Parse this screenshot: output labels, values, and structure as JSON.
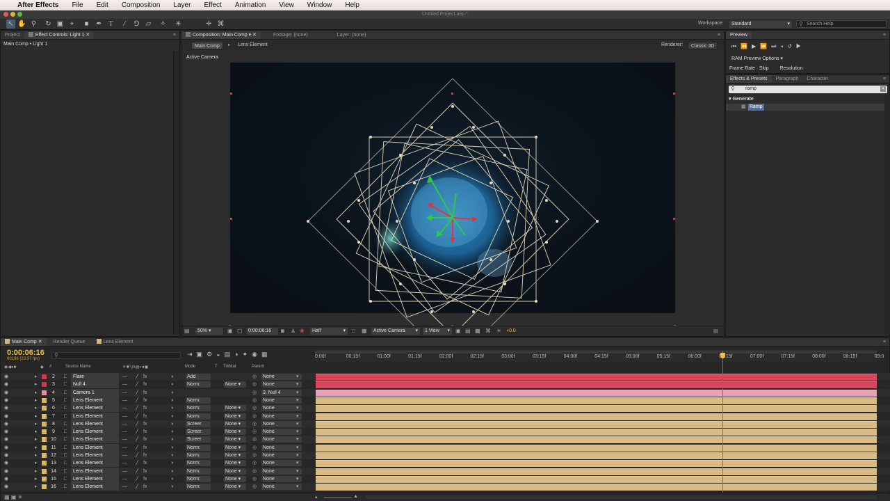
{
  "menubar": {
    "apple": "",
    "app": "After Effects",
    "items": [
      "File",
      "Edit",
      "Composition",
      "Layer",
      "Effect",
      "Animation",
      "View",
      "Window",
      "Help"
    ]
  },
  "window_title": "Untitled Project.aep *",
  "toolbar": {
    "workspace_label": "Workspace:",
    "workspace_value": "Standard",
    "search_placeholder": "Search Help"
  },
  "project_panel": {
    "tabs": [
      "Project",
      "Effect Controls: Light 1"
    ],
    "breadcrumb": "Main Comp • Light 1"
  },
  "comp_panel": {
    "tabs": [
      "Composition: Main Comp",
      "Footage: (none)",
      "Layer: (none)"
    ],
    "subtabs": [
      "Main Comp",
      "Lens Element"
    ],
    "renderer_label": "Renderer:",
    "renderer_value": "Classic 3D",
    "view_label": "Active Camera",
    "footer": {
      "zoom": "50%",
      "timecode": "0:00:06:16",
      "resolution": "Half",
      "camera": "Active Camera",
      "view": "1 View",
      "exposure": "+0.0"
    }
  },
  "preview_panel": {
    "title": "Preview",
    "ram_label": "RAM Preview Options",
    "cols": [
      "Frame Rate",
      "Skip",
      "Resolution"
    ]
  },
  "effects_panel": {
    "tabs": [
      "Effects & Presets",
      "Paragraph",
      "Character"
    ],
    "search": "ramp",
    "category": "Generate",
    "item": "Ramp"
  },
  "timeline": {
    "tabs": [
      "Main Comp",
      "Render Queue",
      "Lens Element"
    ],
    "timecode": "0:00:06:16",
    "frames": "00196 (29.97 fps)",
    "col_headers": {
      "num": "#",
      "source": "Source Name",
      "mode": "Mode",
      "t": "T",
      "trkmat": "TrkMat",
      "parent": "Parent"
    },
    "ruler": [
      "0:00f",
      "00:15f",
      "01:00f",
      "01:15f",
      "02:00f",
      "02:15f",
      "03:00f",
      "03:15f",
      "04:00f",
      "04:15f",
      "05:00f",
      "05:15f",
      "06:00f",
      "06:15f",
      "07:00f",
      "07:15f",
      "08:00f",
      "08:15f",
      "09:0"
    ],
    "playhead_fraction": 0.725,
    "layers": [
      {
        "num": "2",
        "name": "Flare",
        "label": "#c83a4a",
        "mode": "Add",
        "trkmat": "",
        "parent": "None",
        "bar": "#d9465c"
      },
      {
        "num": "3",
        "name": "Null 4",
        "label": "#c83a4a",
        "mode": "Norm:",
        "trkmat": "None",
        "parent": "None",
        "bar": "#d9465c"
      },
      {
        "num": "4",
        "name": "Camera 1",
        "label": "#e78fa6",
        "mode": "",
        "trkmat": "",
        "parent": "3. Null 4",
        "bar": "#e8a2b6"
      },
      {
        "num": "5",
        "name": "Lens Element",
        "label": "#d7b86a",
        "mode": "Norm:",
        "trkmat": "",
        "parent": "None",
        "bar": "#d8bb85"
      },
      {
        "num": "6",
        "name": "Lens Element",
        "label": "#d7b86a",
        "mode": "Norm:",
        "trkmat": "None",
        "parent": "None",
        "bar": "#d8bb85"
      },
      {
        "num": "7",
        "name": "Lens Element",
        "label": "#d7b86a",
        "mode": "Norm:",
        "trkmat": "None",
        "parent": "None",
        "bar": "#d8bb85"
      },
      {
        "num": "8",
        "name": "Lens Element",
        "label": "#d7b86a",
        "mode": "Screer",
        "trkmat": "None",
        "parent": "None",
        "bar": "#d8bb85"
      },
      {
        "num": "9",
        "name": "Lens Element",
        "label": "#d7b86a",
        "mode": "Screer",
        "trkmat": "None",
        "parent": "None",
        "bar": "#d8bb85"
      },
      {
        "num": "10",
        "name": "Lens Element",
        "label": "#d7b86a",
        "mode": "Screer",
        "trkmat": "None",
        "parent": "None",
        "bar": "#d8bb85"
      },
      {
        "num": "11",
        "name": "Lens Element",
        "label": "#d7b86a",
        "mode": "Norm:",
        "trkmat": "None",
        "parent": "None",
        "bar": "#d8bb85"
      },
      {
        "num": "12",
        "name": "Lens Element",
        "label": "#d7b86a",
        "mode": "Norm:",
        "trkmat": "None",
        "parent": "None",
        "bar": "#d8bb85"
      },
      {
        "num": "13",
        "name": "Lens Element",
        "label": "#d7b86a",
        "mode": "Norm:",
        "trkmat": "None",
        "parent": "None",
        "bar": "#d8bb85"
      },
      {
        "num": "14",
        "name": "Lens Element",
        "label": "#d7b86a",
        "mode": "Norm:",
        "trkmat": "None",
        "parent": "None",
        "bar": "#d8bb85"
      },
      {
        "num": "15",
        "name": "Lens Element",
        "label": "#d7b86a",
        "mode": "Norm:",
        "trkmat": "None",
        "parent": "None",
        "bar": "#d8bb85"
      },
      {
        "num": "16",
        "name": "Lens Element",
        "label": "#d7b86a",
        "mode": "Norm:",
        "trkmat": "None",
        "parent": "None",
        "bar": "#d8bb85"
      }
    ]
  },
  "colors": {
    "accent_timecode": "#f0c23a",
    "playhead": "#e0453a",
    "selection": "#4a6a9a"
  }
}
